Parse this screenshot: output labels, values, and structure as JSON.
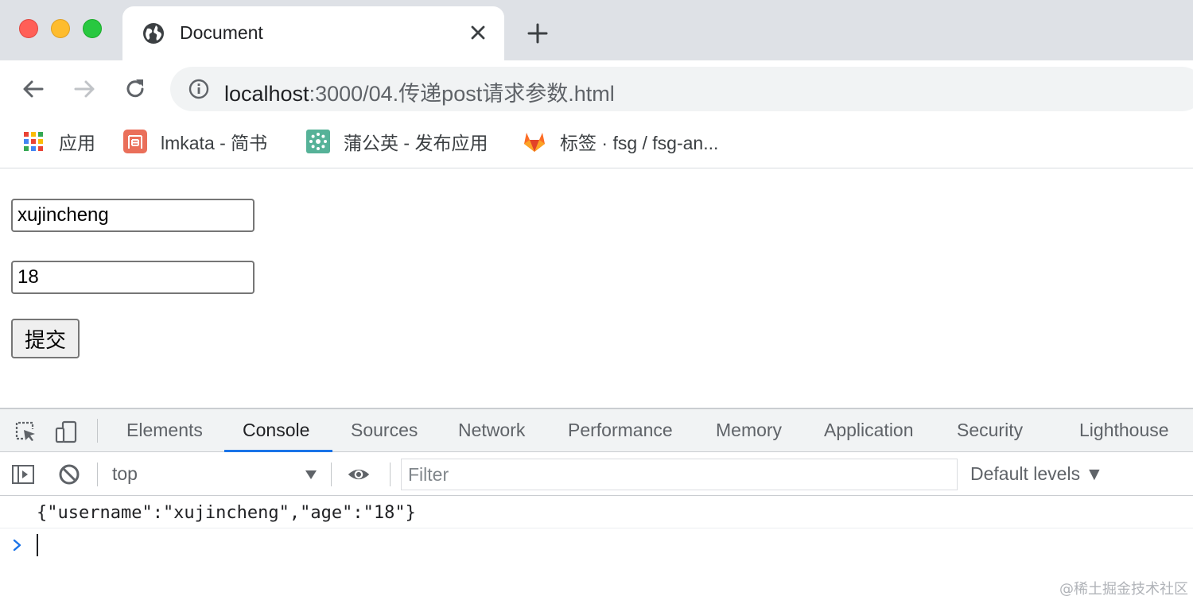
{
  "window": {
    "tab_title": "Document",
    "colors": {
      "close": "#ff5f57",
      "minimize": "#febc2e",
      "zoom": "#28c840"
    }
  },
  "toolbar": {
    "url_host": "localhost",
    "url_path": ":3000/04.传递post请求参数.html"
  },
  "bookmarks": [
    {
      "label": "应用",
      "icon": "apps-grid-icon"
    },
    {
      "label": "lmkata - 简书",
      "icon": "jianshu-icon"
    },
    {
      "label": "蒲公英 - 发布应用",
      "icon": "pgyer-icon"
    },
    {
      "label": "标签 · fsg / fsg-an...",
      "icon": "gitlab-icon"
    }
  ],
  "form": {
    "username_value": "xujincheng",
    "age_value": "18",
    "submit_label": "提交"
  },
  "devtools": {
    "tabs": [
      "Elements",
      "Console",
      "Sources",
      "Network",
      "Performance",
      "Memory",
      "Application",
      "Security",
      "Lighthouse"
    ],
    "active_tab": "Console",
    "accent": "#1a73e8",
    "context": "top",
    "filter_placeholder": "Filter",
    "levels": "Default levels ▼",
    "console_output": "{\"username\":\"xujincheng\",\"age\":\"18\"}"
  },
  "watermark": "@稀土掘金技术社区"
}
